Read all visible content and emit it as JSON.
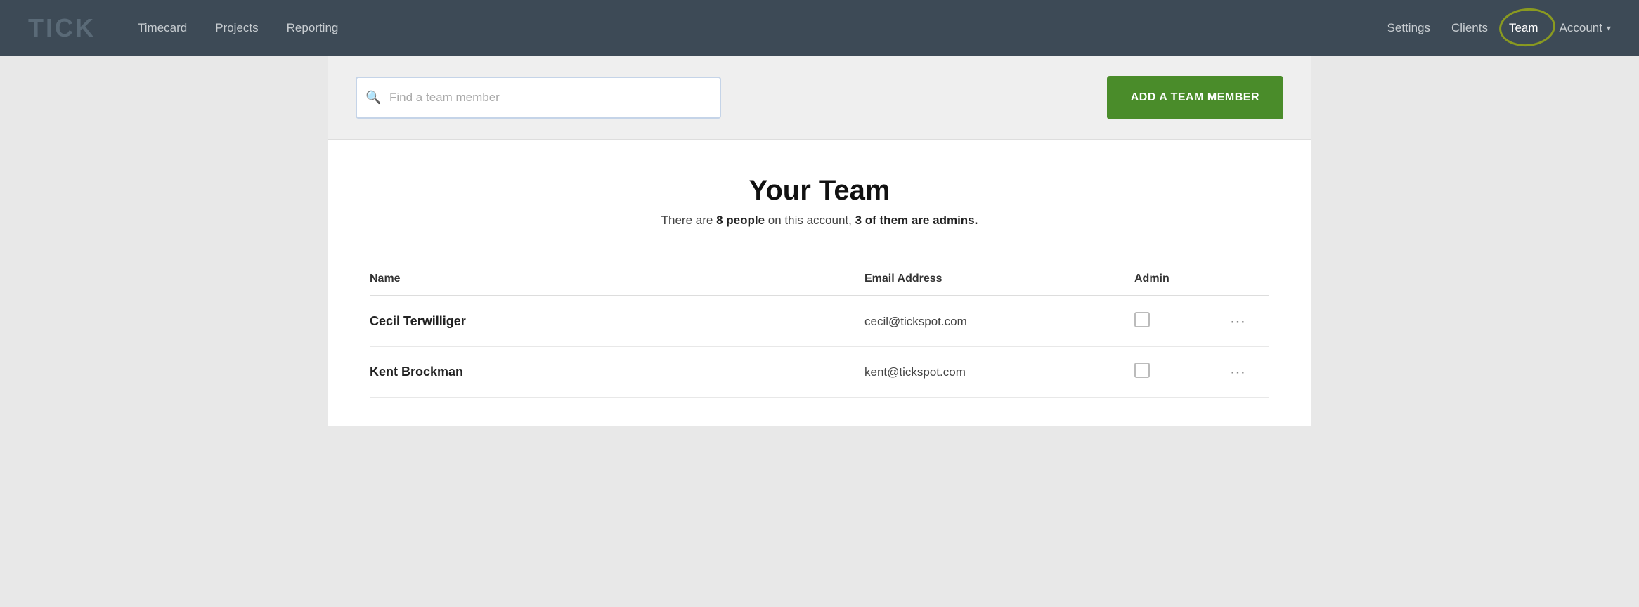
{
  "navbar": {
    "logo": "TICK",
    "nav_items": [
      {
        "label": "Timecard",
        "id": "timecard"
      },
      {
        "label": "Projects",
        "id": "projects"
      },
      {
        "label": "Reporting",
        "id": "reporting"
      }
    ],
    "right_items": [
      {
        "label": "Settings",
        "id": "settings"
      },
      {
        "label": "Clients",
        "id": "clients"
      },
      {
        "label": "Team",
        "id": "team",
        "active": true
      },
      {
        "label": "Account",
        "id": "account",
        "has_dropdown": true
      }
    ]
  },
  "search": {
    "placeholder": "Find a team member"
  },
  "add_button": {
    "label": "ADD A TEAM MEMBER"
  },
  "team_section": {
    "title": "Your Team",
    "subtitle_prefix": "There are ",
    "people_count": "8 people",
    "subtitle_middle": " on this account, ",
    "admin_count": "3 of them are admins.",
    "table": {
      "headers": {
        "name": "Name",
        "email": "Email Address",
        "admin": "Admin"
      },
      "rows": [
        {
          "name": "Cecil Terwilliger",
          "email": "cecil@tickspot.com",
          "admin": false
        },
        {
          "name": "Kent Brockman",
          "email": "kent@tickspot.com",
          "admin": false
        }
      ]
    }
  }
}
